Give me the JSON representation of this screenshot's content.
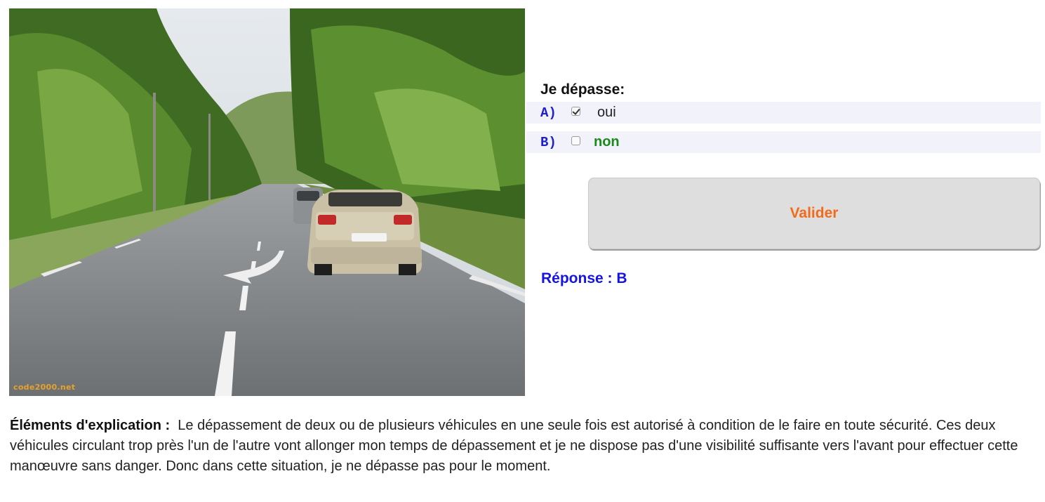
{
  "image": {
    "watermark": "code2000.net"
  },
  "question": {
    "text": "Je dépasse:",
    "options": [
      {
        "letter": "A)",
        "label": "oui",
        "checked": true
      },
      {
        "letter": "B)",
        "label": "non",
        "checked": false
      }
    ]
  },
  "validate_button": {
    "label": "Valider"
  },
  "answer": {
    "text": "Réponse : B"
  },
  "explanation": {
    "label": "Éléments d'explication :",
    "text": "Le dépassement de deux ou de plusieurs véhicules en une seule fois est autorisé à condition de le faire en toute sécurité. Ces deux véhicules circulant trop près l'un de l'autre vont allonger mon temps de dépassement et je ne dispose pas d'une visibilité suffisante vers l'avant pour effectuer cette manœuvre sans danger. Donc dans cette situation, je ne dépasse pas pour le moment."
  },
  "colors": {
    "option_letter": "#1f1fd0",
    "option_b_text": "#1b8a1b",
    "button_text": "#f26a1b",
    "answer_text": "#1414e6"
  }
}
